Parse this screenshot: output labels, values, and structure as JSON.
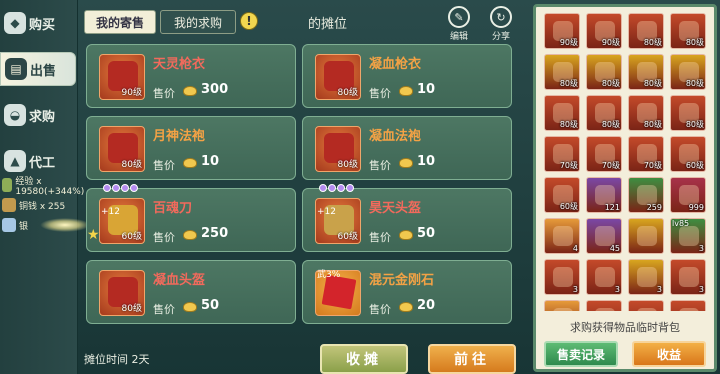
{
  "nav": {
    "items": [
      {
        "label": "购买",
        "icon": "bag-icon"
      },
      {
        "label": "出售",
        "icon": "stall-icon"
      },
      {
        "label": "求购",
        "icon": "bowl-icon"
      },
      {
        "label": "代工",
        "icon": "anvil-icon"
      }
    ]
  },
  "rewards": [
    {
      "text": "经验 x 19580(+344%)"
    },
    {
      "text": "铜钱 x 255"
    },
    {
      "text": "银"
    }
  ],
  "tabs": {
    "my_consign": "我的寄售",
    "my_request": "我的求购"
  },
  "stall_title": "的摊位",
  "header_buttons": {
    "edit": "编辑",
    "share": "分享"
  },
  "price_label": "售价",
  "cards": [
    {
      "name": "天灵枪衣",
      "level": "90级",
      "price": "300",
      "name_color": "red"
    },
    {
      "name": "凝血枪衣",
      "level": "80级",
      "price": "10",
      "name_color": "orange"
    },
    {
      "name": "月神法袍",
      "level": "80级",
      "price": "10",
      "name_color": "orange"
    },
    {
      "name": "凝血法袍",
      "level": "80级",
      "price": "10",
      "name_color": "orange"
    },
    {
      "name": "百魂刀",
      "level": "60级",
      "price": "250",
      "name_color": "red",
      "enhance": "+12"
    },
    {
      "name": "昊天头盔",
      "level": "60级",
      "price": "50",
      "name_color": "red",
      "enhance": "+12"
    },
    {
      "name": "凝血头盔",
      "level": "80级",
      "price": "50",
      "name_color": "red"
    },
    {
      "name": "混元金刚石",
      "level": "",
      "price": "20",
      "name_color": "orange",
      "tag": "武3%"
    }
  ],
  "stall_time": "摊位时间 2天",
  "buttons": {
    "withdraw": "收摊",
    "goto": "前往"
  },
  "inventory": {
    "slots": [
      {
        "text": "90级",
        "color": "#c44a2a"
      },
      {
        "text": "90级",
        "color": "#c44a2a"
      },
      {
        "text": "80级",
        "color": "#c44a2a"
      },
      {
        "text": "80级",
        "color": "#c44a2a"
      },
      {
        "text": "80级",
        "color": "#d8a51f"
      },
      {
        "text": "80级",
        "color": "#d8a51f"
      },
      {
        "text": "80级",
        "color": "#d8a51f"
      },
      {
        "text": "80级",
        "color": "#d8a51f"
      },
      {
        "text": "80级",
        "color": "#c44a2a"
      },
      {
        "text": "80级",
        "color": "#c44a2a"
      },
      {
        "text": "80级",
        "color": "#c44a2a"
      },
      {
        "text": "80级",
        "color": "#c44a2a"
      },
      {
        "text": "70级",
        "color": "#c44a2a"
      },
      {
        "text": "70级",
        "color": "#c44a2a"
      },
      {
        "text": "70级",
        "color": "#c44a2a"
      },
      {
        "text": "60级",
        "color": "#c44a2a"
      },
      {
        "text": "60级",
        "color": "#c44a2a"
      },
      {
        "text": "121",
        "color": "#7a48a6"
      },
      {
        "text": "259",
        "color": "#3e8e41"
      },
      {
        "text": "999",
        "color": "#a8324a"
      },
      {
        "text": "4",
        "color": "#e69a3a"
      },
      {
        "text": "45",
        "color": "#7a48a6"
      },
      {
        "text": "",
        "color": "#d8a51f"
      },
      {
        "text": "3",
        "color": "#3e8e41",
        "tl": "lv85"
      },
      {
        "text": "3",
        "color": "#c44a2a"
      },
      {
        "text": "3",
        "color": "#c44a2a"
      },
      {
        "text": "3",
        "color": "#d8a51f"
      },
      {
        "text": "3",
        "color": "#c44a2a"
      },
      {
        "text": "",
        "color": "#e69a3a"
      },
      {
        "text": "",
        "color": "#c44a2a"
      },
      {
        "text": "",
        "color": "#c44a2a"
      },
      {
        "text": "",
        "color": "#c44a2a"
      }
    ],
    "note": "求购获得物品临时背包"
  },
  "right_buttons": {
    "records": "售卖记录",
    "profit": "收益"
  }
}
